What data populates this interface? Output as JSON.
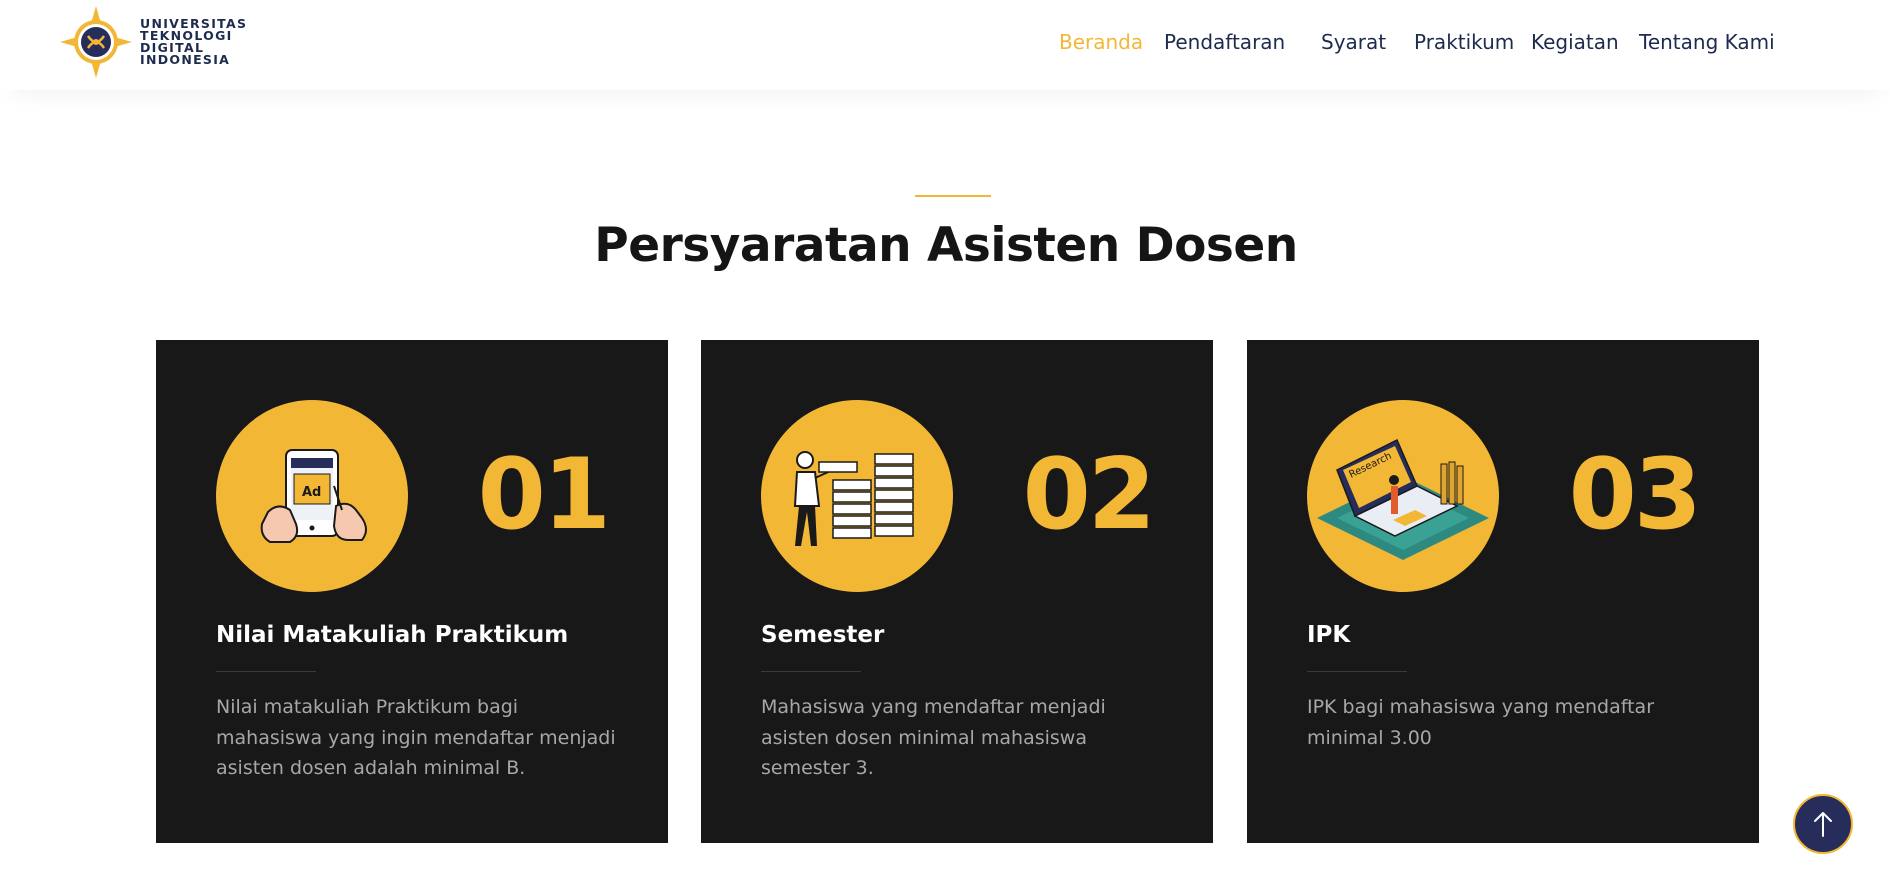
{
  "logo": {
    "lines": [
      "UNIVERSITAS",
      "TEKNOLOGI",
      "DIGITAL",
      "INDONESIA"
    ],
    "icon": "university-emblem-icon"
  },
  "nav": {
    "items": [
      {
        "label": "Beranda",
        "active": true
      },
      {
        "label": "Pendaftaran",
        "active": false
      },
      {
        "label": "Syarat",
        "active": false
      },
      {
        "label": "Praktikum",
        "active": false
      },
      {
        "label": "Kegiatan",
        "active": false
      },
      {
        "label": "Tentang Kami",
        "active": false
      }
    ]
  },
  "section": {
    "title": "Persyaratan Asisten Dosen"
  },
  "cards": [
    {
      "number": "01",
      "title": "Nilai Matakuliah Praktikum",
      "description": "Nilai matakuliah Praktikum bagi mahasiswa yang ingin mendaftar menjadi asisten dosen adalah minimal B.",
      "icon": "phone-ad-illustration-icon"
    },
    {
      "number": "02",
      "title": "Semester",
      "description": "Mahasiswa yang mendaftar menjadi asisten dosen minimal mahasiswa semester 3.",
      "icon": "person-stacks-illustration-icon"
    },
    {
      "number": "03",
      "title": "IPK",
      "description": "IPK bagi mahasiswa yang mendaftar minimal 3.00",
      "icon": "laptop-research-illustration-icon",
      "illustration_text": "Research"
    }
  ],
  "back_to_top": {
    "icon": "arrow-up-icon"
  },
  "colors": {
    "accent": "#f3b736",
    "card_bg": "#181818",
    "nav_text": "#1d2b4f",
    "to_top_bg": "#262d5a"
  }
}
